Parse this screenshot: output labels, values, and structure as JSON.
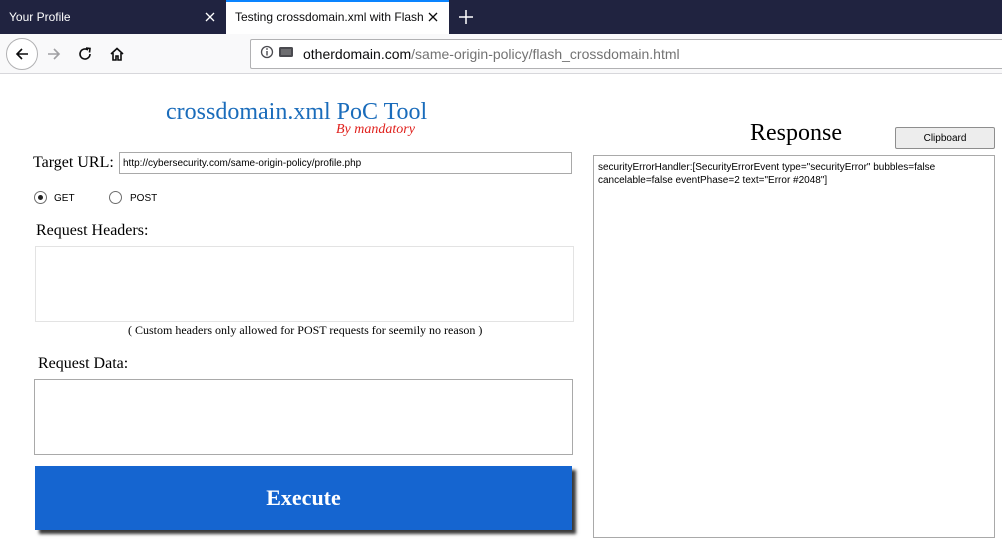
{
  "browser": {
    "tabs": [
      {
        "title": "Your Profile",
        "active": false
      },
      {
        "title": "Testing crossdomain.xml with Flash",
        "active": true
      }
    ],
    "url": {
      "domain": "otherdomain.com",
      "path": "/same-origin-policy/flash_crossdomain.html"
    },
    "icons": {
      "tab_close": "close-icon",
      "new_tab": "plus-icon",
      "back": "back-arrow-icon",
      "forward": "forward-arrow-icon",
      "reload": "reload-icon",
      "home": "home-icon",
      "site_info": "info-icon",
      "plugin": "plugin-icon"
    }
  },
  "page": {
    "title": "crossdomain.xml PoC Tool",
    "subtitle": "By mandatory",
    "target_label": "Target URL:",
    "target_value": "http://cybersecurity.com/same-origin-policy/profile.php",
    "methods": [
      {
        "label": "GET",
        "selected": true
      },
      {
        "label": "POST",
        "selected": false
      }
    ],
    "headers_label": "Request Headers:",
    "headers_value": "",
    "headers_note": "( Custom headers only allowed for POST requests for seemily no reason )",
    "data_label": "Request Data:",
    "data_value": "",
    "execute_label": "Execute",
    "response_title": "Response",
    "clipboard_label": "Clipboard",
    "response_text": "securityErrorHandler:[SecurityErrorEvent type=\"securityError\" bubbles=false cancelable=false eventPhase=2 text=\"Error #2048\"]"
  },
  "colors": {
    "tabstrip": "#202340",
    "title_blue": "#1a6cbb",
    "subtitle_red": "#e0201c",
    "execute_blue": "#1565d0"
  }
}
